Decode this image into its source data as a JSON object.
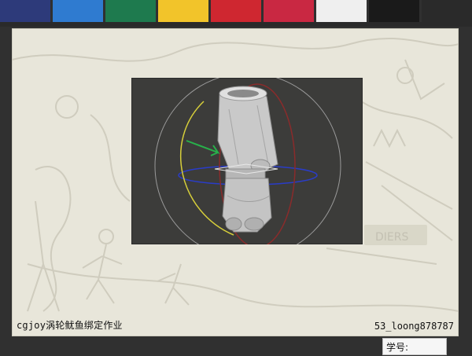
{
  "swatches": [
    "#2d3a7a",
    "#2f7bd0",
    "#1e7a4e",
    "#f2c42a",
    "#cf2730",
    "#c92842",
    "#efefef",
    "#1a1a1a",
    "#2a2a2a"
  ],
  "footer": {
    "left_text": "cgjoy涡轮鱿鱼绑定作业",
    "right_text": "53_loong878787"
  },
  "id_tag": {
    "label": "学号:"
  },
  "viewport": {
    "background": "#3c3c3a",
    "model_color": "#cfcfcf",
    "gizmo_colors": {
      "ring_yellow": "#d7cf3a",
      "ring_red": "#8a2b2b",
      "ring_blue": "#2a3cc8",
      "ring_outer": "#9a9a9a",
      "arrow_green": "#28b04a"
    }
  }
}
